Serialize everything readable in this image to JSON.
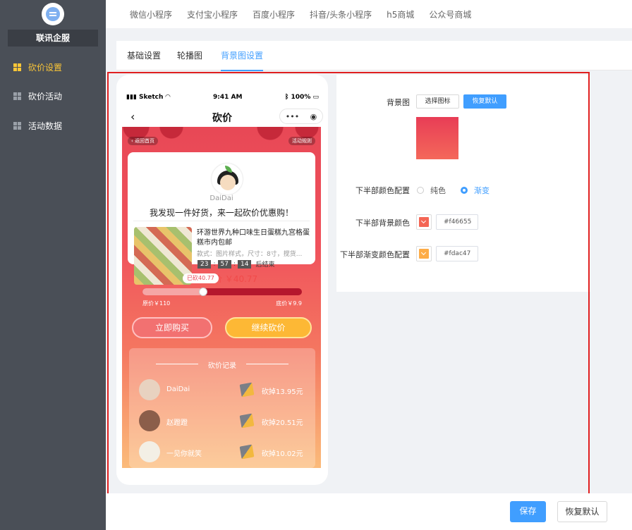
{
  "sidebar": {
    "brand": "联讯企服",
    "items": [
      {
        "label": "砍价设置",
        "active": true
      },
      {
        "label": "砍价活动",
        "active": false
      },
      {
        "label": "活动数据",
        "active": false
      }
    ]
  },
  "topbar": {
    "tabs": [
      "微信小程序",
      "支付宝小程序",
      "百度小程序",
      "抖音/头条小程序",
      "h5商城",
      "公众号商城"
    ]
  },
  "tabs": [
    {
      "label": "基础设置",
      "active": false
    },
    {
      "label": "轮播图",
      "active": false
    },
    {
      "label": "背景图设置",
      "active": true
    }
  ],
  "phone": {
    "status": {
      "carrier": "Sketch",
      "time": "9:41 AM",
      "battery": "100%"
    },
    "title": "砍价",
    "capsule_more": "•••",
    "back_home": "返回首页",
    "rules": "活动规则",
    "username": "DaiDai",
    "slogan": "我发现一件好货，来一起砍价优惠购！",
    "goods": {
      "name": "环游世界九种口味生日蛋糕九宫格蛋糕市内包邮",
      "spec": "款式：图片样式，尺寸：8寸，搅货...",
      "countdown": [
        "23",
        "57",
        "14"
      ],
      "countdown_suffix": "后结束",
      "current_price": "当前价 ￥40.77"
    },
    "cut_badge": "已砍40.77",
    "progress": 0.38,
    "original_price": "原价￥110",
    "floor_price": "底价￥9.9",
    "buy_button": "立即购买",
    "continue_button": "继续砍价",
    "records_title": "砍价记录",
    "records": [
      {
        "name": "DaiDai",
        "cut": "砍掉13.95元"
      },
      {
        "name": "赵蹬蹬",
        "cut": "砍掉20.51元"
      },
      {
        "name": "一见你就笑",
        "cut": "砍掉10.02元"
      }
    ]
  },
  "settings": {
    "bg_label": "背景图",
    "choose_icon_button": "选择图标",
    "restore_button": "恢复默认",
    "lower_color_config_label": "下半部颜色配置",
    "option_solid": "纯色",
    "option_gradient": "渐变",
    "selected_option": "渐变",
    "lower_bg_color_label": "下半部背景颜色",
    "lower_bg_color": "#f46655",
    "lower_gradient_label": "下半部渐变颜色配置",
    "lower_gradient_color": "#fdac47"
  },
  "footer": {
    "save_button": "保存",
    "restore_button": "恢复默认"
  },
  "colors": {
    "accent": "#409eff",
    "active_nav": "#fbc637",
    "highlight_frame": "#e02020"
  }
}
